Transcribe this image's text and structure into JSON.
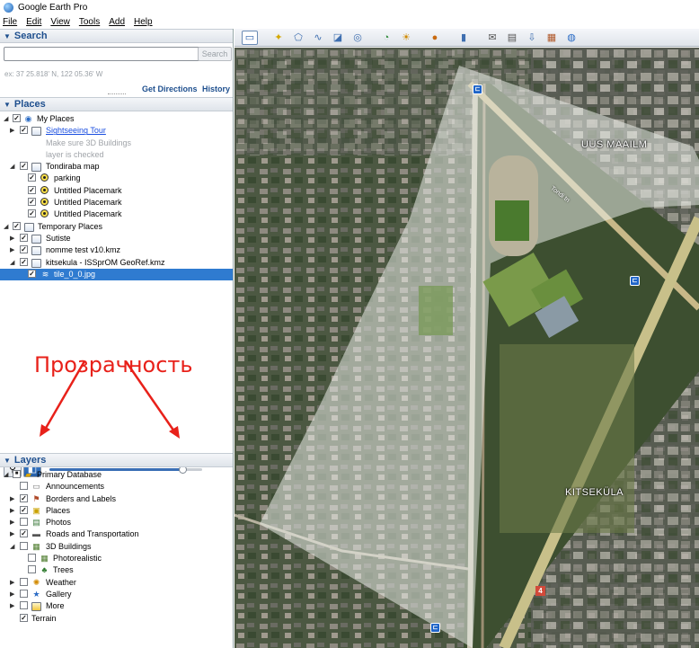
{
  "window": {
    "title": "Google Earth Pro"
  },
  "menu": [
    "File",
    "Edit",
    "View",
    "Tools",
    "Add",
    "Help"
  ],
  "search": {
    "header": "Search",
    "input_value": "",
    "button": "Search",
    "hint": "ex: 37 25.818' N, 122 05.36' W",
    "get_directions": "Get Directions",
    "history": "History"
  },
  "places": {
    "header": "Places",
    "items": [
      {
        "label": "My Places"
      },
      {
        "label": "Sightseeing Tour",
        "sub1": "Make sure 3D Buildings",
        "sub2": "layer is checked"
      },
      {
        "label": "Tondiraba map"
      },
      {
        "label": "parking"
      },
      {
        "label": "Untitled Placemark"
      },
      {
        "label": "Untitled Placemark"
      },
      {
        "label": "Untitled Placemark"
      },
      {
        "label": "Temporary Places"
      },
      {
        "label": "Sutiste"
      },
      {
        "label": "nomme test v10.kmz"
      },
      {
        "label": "kitsekula - ISSprOM GeoRef.kmz"
      },
      {
        "label": "tile_0_0.jpg"
      }
    ]
  },
  "annotation": {
    "text": "Прозрачность"
  },
  "transparency": {
    "value": 0.87
  },
  "layers": {
    "header": "Layers",
    "items": [
      {
        "label": "Primary Database"
      },
      {
        "label": "Announcements"
      },
      {
        "label": "Borders and Labels"
      },
      {
        "label": "Places"
      },
      {
        "label": "Photos"
      },
      {
        "label": "Roads and Transportation"
      },
      {
        "label": "3D Buildings"
      },
      {
        "label": "Photorealistic"
      },
      {
        "label": "Trees"
      },
      {
        "label": "Weather"
      },
      {
        "label": "Gallery"
      },
      {
        "label": "More"
      },
      {
        "label": "Terrain"
      }
    ]
  },
  "map": {
    "labels": {
      "uus_maailm": "UUS MAAILM",
      "kitsekula": "KITSEKÜLA",
      "road": "Tondi tn",
      "route_number": "4"
    },
    "colors": {
      "overlay": "#e9ece8",
      "accent": "#e8211a",
      "selection": "#2f7bd0"
    }
  }
}
